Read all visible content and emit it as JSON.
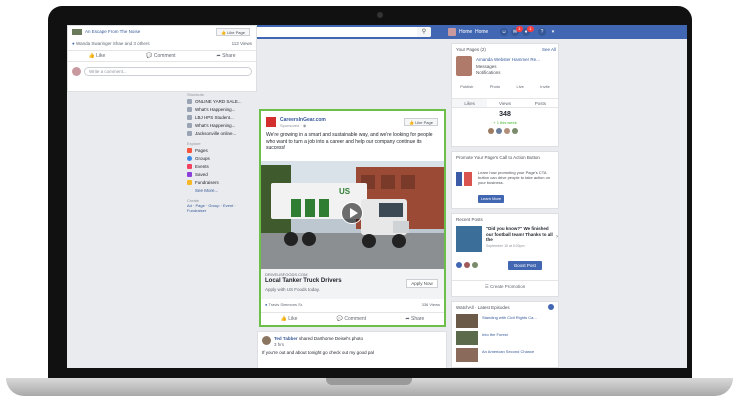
{
  "topbar": {
    "search_placeholder": "Search",
    "user_name": "Home",
    "home": "Home",
    "badge_1": "1",
    "badge_2": "1"
  },
  "left_nav": {
    "profile": "Name Donders Fa...",
    "items": [
      "News Feed",
      "Messenger",
      "Watch",
      "Marketplace"
    ],
    "shortcuts_header": "Shortcuts",
    "shortcuts": [
      "ONLINE YARD SALE...",
      "What's Happening...",
      "LBJ HPS Student...",
      "What's Happening...",
      "Jacksonville online..."
    ],
    "explore_header": "Explore",
    "explore": [
      "Pages",
      "Groups",
      "Events",
      "Saved",
      "Fundraisers"
    ],
    "see_more": "See More...",
    "create_header": "Create",
    "create_links": "Ad · Page · Group · Event · Fundraiser"
  },
  "feed": {
    "top_post": {
      "title": "An Escape From The Noise",
      "like_page": "Like Page",
      "meta": "Wanda Swaringer Shae and 3 others",
      "views": "113 Views",
      "actions": [
        "Like",
        "Comment",
        "Share"
      ],
      "comment_placeholder": "Write a comment..."
    },
    "ad": {
      "page_name": "CareersInGear.com",
      "sponsored": "Sponsored · ◉",
      "like_page": "Like Page",
      "body": "We're growing in a smart and sustainable way, and we're looking for people who want to turn a job into a career and help our company continue its success!",
      "domain": "DRIVEUSFOODS.COM",
      "headline": "Local Tanker Truck Drivers",
      "description": "Apply with US Foods today.",
      "cta": "Apply Now",
      "truck_text": "US",
      "engaged": "Travis Simmons Sr.",
      "views": "336 Views",
      "actions": [
        "Like",
        "Comment",
        "Share"
      ]
    },
    "bottom_post": {
      "name": "Ted Tabber",
      "shared": "shared Darthome Deisel's photo",
      "time": "3 hrs",
      "text": "If you're out and about tonight go check out my good pal"
    }
  },
  "right": {
    "pages_header": "Your Pages (2)",
    "see_all": "See All",
    "page_name": "Amanda Webster Hammer Re...",
    "messages": "Messages",
    "notifications": "Notifications",
    "page_actions": [
      "Publish",
      "Photo",
      "Live",
      "Invite"
    ],
    "tabs": [
      "Likes",
      "Views",
      "Posts"
    ],
    "likes_count": "348",
    "likes_sub": "+ 1 this week",
    "promote_header": "Promote Your Page's Call to Action Button",
    "promote_text": "Learn how promoting your Page's CTA button can drive people to take action on your business.",
    "learn_more": "Learn More",
    "recent_header": "Recent Posts",
    "recent_text": "\"Did you know?\" We finished our football team! Thanks to all the",
    "recent_date": "September 15 at 5:00pm",
    "boost": "Boost Post",
    "create_promo": "Create Promotion",
    "watch_header": "WatchAll · Latest Episodes",
    "watch_items": [
      "Standing with Civil Rights Ca...",
      "Into the Forest",
      "An American Second Chance"
    ]
  },
  "colors": {
    "brand": "#4267b2",
    "ad_border": "#6cc04a",
    "link": "#365899",
    "badge": "#fa3e3e"
  }
}
